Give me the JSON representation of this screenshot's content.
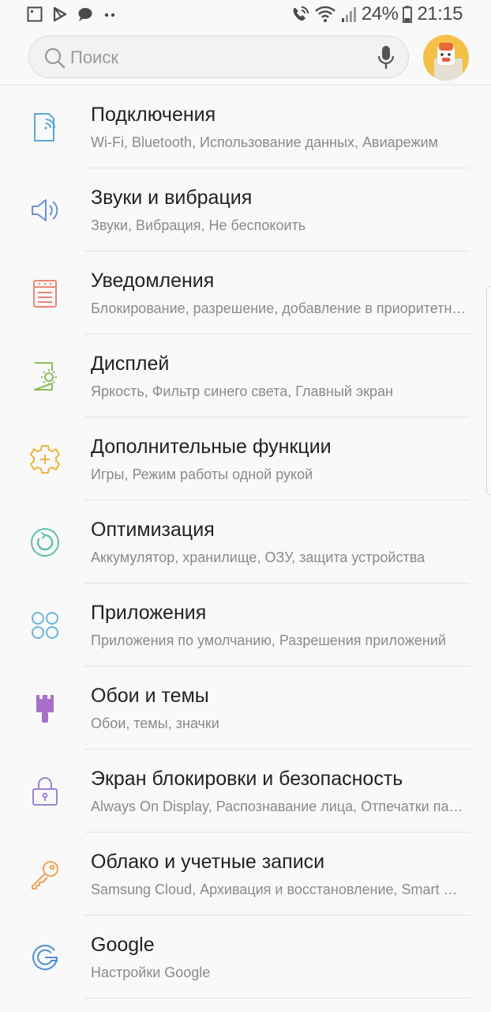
{
  "status_bar": {
    "battery": "24%",
    "time": "21:15",
    "left_icons": [
      "notification-square-icon",
      "play-store-icon",
      "messages-icon",
      "more-dots-icon"
    ],
    "right_icons": [
      "wifi-call-icon",
      "wifi-icon",
      "signal-icon",
      "battery-icon"
    ]
  },
  "search": {
    "placeholder": "Поиск"
  },
  "colors": {
    "connections": "#5aa9d6",
    "sounds": "#6b8fd6",
    "notifications": "#ea8574",
    "display": "#8bbd5a",
    "advanced": "#efb53e",
    "optimization": "#5fc0a9",
    "apps": "#68b7dc",
    "wallpapers": "#a86ec8",
    "lockscreen": "#9b84d4",
    "cloud": "#efa255",
    "google": "#4f8fd6"
  },
  "items": [
    {
      "title": "Подключения",
      "subtitle": "Wi-Fi, Bluetooth, Использование данных, Авиарежим",
      "icon": "connections-icon"
    },
    {
      "title": "Звуки и вибрация",
      "subtitle": "Звуки, Вибрация, Не беспокоить",
      "icon": "sound-icon"
    },
    {
      "title": "Уведомления",
      "subtitle": "Блокирование, разрешение, добавление в приоритетные",
      "icon": "notifications-icon"
    },
    {
      "title": "Дисплей",
      "subtitle": "Яркость, Фильтр синего света, Главный экран",
      "icon": "display-icon"
    },
    {
      "title": "Дополнительные функции",
      "subtitle": "Игры, Режим работы одной рукой",
      "icon": "advanced-features-icon"
    },
    {
      "title": "Оптимизация",
      "subtitle": "Аккумулятор, хранилище, ОЗУ, защита устройства",
      "icon": "optimization-icon"
    },
    {
      "title": "Приложения",
      "subtitle": "Приложения по умолчанию, Разрешения приложений",
      "icon": "apps-icon"
    },
    {
      "title": "Обои и темы",
      "subtitle": "Обои, темы, значки",
      "icon": "wallpaper-icon"
    },
    {
      "title": "Экран блокировки и безопасность",
      "subtitle": "Always On Display, Распознавание лица, Отпечатки пальцев, Ра...",
      "icon": "lock-icon"
    },
    {
      "title": "Облако и учетные записи",
      "subtitle": "Samsung Cloud, Архивация и восстановление, Smart Switch",
      "icon": "key-icon"
    },
    {
      "title": "Google",
      "subtitle": "Настройки Google",
      "icon": "google-icon"
    }
  ]
}
